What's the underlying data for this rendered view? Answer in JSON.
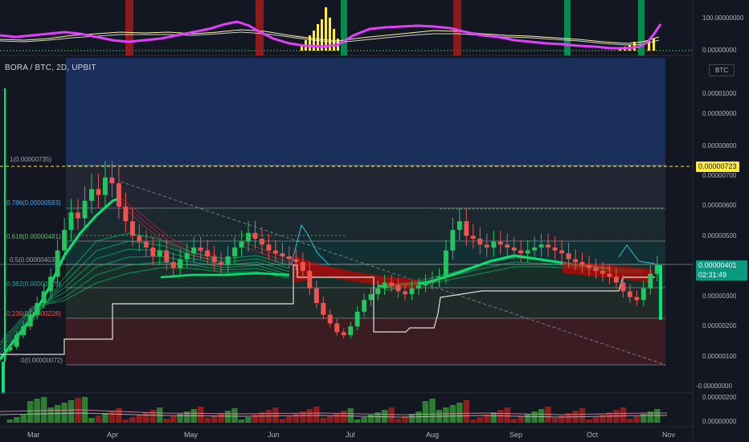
{
  "header": {
    "symbol": "BORA / BTC, 2D, UPBIT",
    "currency": "BTC"
  },
  "price_tags": {
    "alert_level": "0.00000723",
    "last_price": "0.00000401",
    "countdown": "02:31:49"
  },
  "colors": {
    "background": "#131722",
    "up": "#22c55e",
    "down": "#ef5350",
    "ribbon_up": "#00e676",
    "ribbon_down": "#ff1744",
    "oscillator": "#e040fb",
    "signal": "#fff59d",
    "alert": "#ffeb3b",
    "last_price": "#089981"
  },
  "chart_data": [
    {
      "type": "line",
      "panel": "oscillator",
      "y_ticks": [
        "100.00000000",
        "0.00000000"
      ],
      "series": []
    },
    {
      "type": "candlestick",
      "panel": "price",
      "title": "BORA / BTC, 2D, UPBIT",
      "x_ticks": [
        "Mar",
        "Apr",
        "May",
        "Jun",
        "Jul",
        "Aug",
        "Sep",
        "Oct",
        "Nov"
      ],
      "y_ticks": [
        "0.00001000",
        "0.00000900",
        "0.00000800",
        "0.00000700",
        "0.00000600",
        "0.00000500",
        "0.00000400",
        "0.00000300",
        "0.00000200",
        "0.00000100",
        "-0.00000000"
      ],
      "ylim": [
        -3e-07,
        1.06e-05
      ],
      "fib_levels": [
        {
          "label": "1(0.00000735)",
          "value": 7.35e-06
        },
        {
          "label": "0.786(0.00000593)",
          "value": 5.93e-06
        },
        {
          "label": "0.618(0.00000481)",
          "value": 4.81e-06
        },
        {
          "label": "0.5(0.00000403)",
          "value": 4.03e-06
        },
        {
          "label": "0.382(0.00000325)",
          "value": 3.25e-06
        },
        {
          "label": "0.236(0.00000228)",
          "value": 2.28e-06
        },
        {
          "label": "0(0.00000072)",
          "value": 7.2e-07
        }
      ],
      "closes": [
        1.2e-06,
        1.6e-06,
        1.9e-06,
        2.3e-06,
        2.7e-06,
        3.1e-06,
        3.6e-06,
        4.5e-06,
        5.2e-06,
        5.8e-06,
        5.6e-06,
        6.2e-06,
        6.6e-06,
        6.4e-06,
        7e-06,
        6.8e-06,
        6e-06,
        5.5e-06,
        5e-06,
        4.8e-06,
        4.6e-06,
        4.3e-06,
        4.5e-06,
        4.1e-06,
        3.9e-06,
        4.2e-06,
        4.4e-06,
        4.6e-06,
        4.5e-06,
        4.3e-06,
        4.1e-06,
        4e-06,
        4.3e-06,
        4.6e-06,
        4.8e-06,
        5.1e-06,
        4.9e-06,
        4.7e-06,
        4.5e-06,
        4.4e-06,
        4.3e-06,
        4.2e-06,
        4.1e-06,
        3.8e-06,
        3.2e-06,
        2.7e-06,
        2.3e-06,
        2e-06,
        1.7e-06,
        1.6e-06,
        1.9e-06,
        2.4e-06,
        2.8e-06,
        3e-06,
        3.2e-06,
        3.4e-06,
        3.3e-06,
        3.1e-06,
        3e-06,
        3.2e-06,
        3.3e-06,
        3.4e-06,
        3.5e-06,
        3.6e-06,
        4.5e-06,
        5.2e-06,
        5.5e-06,
        5e-06,
        4.9e-06,
        4.7e-06,
        4.6e-06,
        4.8e-06,
        4.7e-06,
        4.6e-06,
        4.5e-06,
        4.4e-06,
        4.5e-06,
        4.6e-06,
        4.7e-06,
        4.6e-06,
        4.5e-06,
        4.4e-06,
        4.2e-06,
        4.1e-06,
        4e-06,
        3.9e-06,
        3.8e-06,
        3.7e-06,
        3.6e-06,
        3.4e-06,
        3.1e-06,
        2.9e-06,
        2.8e-06,
        3.2e-06,
        3.7e-06,
        4e-06
      ],
      "highs_peak": 7.35e-06,
      "lows_trough": 7.2e-07
    },
    {
      "type": "bar",
      "panel": "volume",
      "y_ticks": [
        "0.00000200",
        "0.00000000"
      ],
      "series": []
    }
  ]
}
